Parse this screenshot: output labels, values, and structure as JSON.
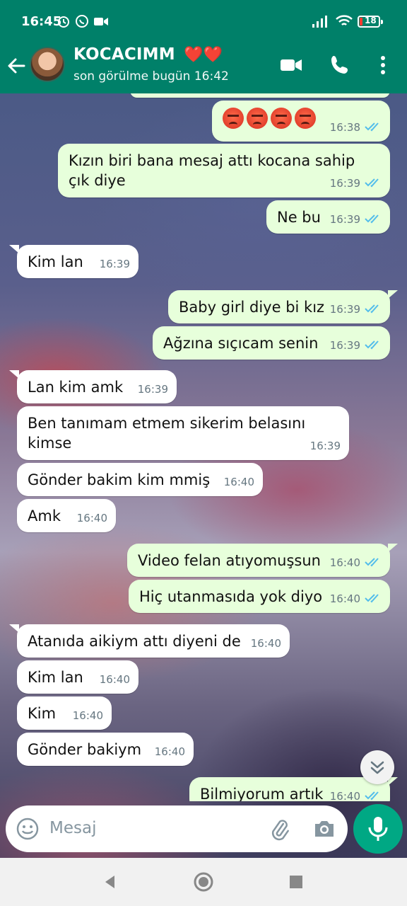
{
  "status_bar": {
    "time": "16:45",
    "battery": "18"
  },
  "header": {
    "contact_name": "KOCACIMM",
    "contact_hearts": "❤️❤️",
    "last_seen": "son görülme bugün 16:42"
  },
  "messages": [
    {
      "dir": "out",
      "text": "",
      "emoji_count": 4,
      "time": "16:38"
    },
    {
      "dir": "out",
      "text": "Kızın biri bana mesaj attı kocana sahip çık diye",
      "time": "16:39"
    },
    {
      "dir": "out",
      "text": "Ne bu",
      "time": "16:39"
    },
    {
      "dir": "in",
      "text": "Kim lan",
      "time": "16:39"
    },
    {
      "dir": "out",
      "text": "Baby girl diye bi kız",
      "time": "16:39"
    },
    {
      "dir": "out",
      "text": "Ağzına sıçıcam senin",
      "time": "16:39"
    },
    {
      "dir": "in",
      "text": "Lan kim amk",
      "time": "16:39"
    },
    {
      "dir": "in",
      "text": "Ben tanımam etmem sikerim belasını kimse",
      "time": "16:39"
    },
    {
      "dir": "in",
      "text": "Gönder bakim kim mmiş",
      "time": "16:40"
    },
    {
      "dir": "in",
      "text": "Amk",
      "time": "16:40"
    },
    {
      "dir": "out",
      "text": "Video felan atıyomuşsun",
      "time": "16:40"
    },
    {
      "dir": "out",
      "text": "Hiç utanmasıda yok diyo",
      "time": "16:40"
    },
    {
      "dir": "in",
      "text": "Atanıda aikiym attı diyeni de",
      "time": "16:40"
    },
    {
      "dir": "in",
      "text": "Kim lan",
      "time": "16:40"
    },
    {
      "dir": "in",
      "text": "Kim",
      "time": "16:40"
    },
    {
      "dir": "in",
      "text": "Gönder bakiym",
      "time": "16:40"
    },
    {
      "dir": "out",
      "text": "Bilmiyorum artık",
      "time": "16:40"
    }
  ],
  "input": {
    "placeholder": "Mesaj"
  },
  "colors": {
    "header": "#008069",
    "outgoing_bubble": "#e7ffdb",
    "incoming_bubble": "#ffffff",
    "read_ticks": "#53bdeb",
    "mic_button": "#00a884"
  },
  "icons": {
    "back": "arrow-left-icon",
    "video_call": "video-camera-icon",
    "voice_call": "phone-icon",
    "menu": "more-vertical-icon",
    "emoji": "emoji-icon",
    "attach": "paperclip-icon",
    "camera": "camera-icon",
    "mic": "microphone-icon",
    "scroll_down": "double-chevron-down-icon"
  }
}
